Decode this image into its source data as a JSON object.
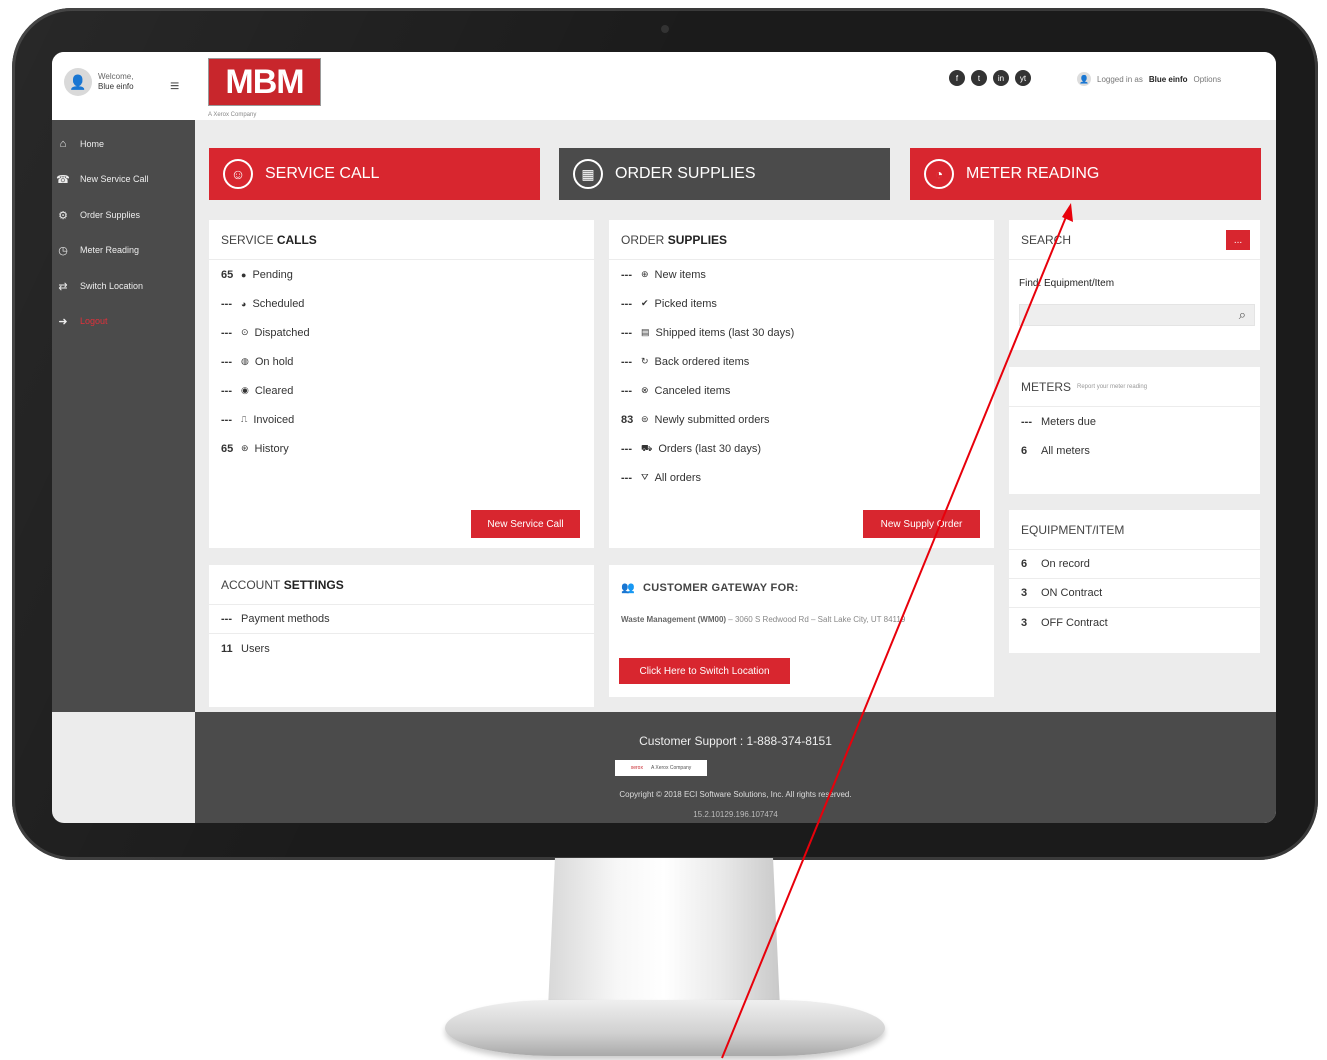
{
  "header": {
    "welcome": "Welcome,",
    "user": "Blue einfo",
    "logo": "MBM",
    "logo_tag": "A Xerox Company",
    "logged_in_label": "Logged in as",
    "logged_in_user": "Blue einfo",
    "options": "Options",
    "socials": [
      "f",
      "t",
      "in",
      "yt"
    ]
  },
  "sidebar": {
    "items": [
      {
        "icon": "⌂",
        "label": "Home"
      },
      {
        "icon": "☎",
        "label": "New Service Call"
      },
      {
        "icon": "⚙",
        "label": "Order Supplies"
      },
      {
        "icon": "◷",
        "label": "Meter Reading"
      },
      {
        "icon": "⇄",
        "label": "Switch Location"
      },
      {
        "icon": "➜",
        "label": "Logout"
      }
    ]
  },
  "tiles": {
    "service_call": "SERVICE CALL",
    "order_supplies": "ORDER SUPPLIES",
    "meter_reading": "METER READING"
  },
  "service_calls": {
    "title_light": "SERVICE",
    "title_bold": "CALLS",
    "rows": [
      {
        "count": "65",
        "label": "Pending"
      },
      {
        "count": "---",
        "label": "Scheduled"
      },
      {
        "count": "---",
        "label": "Dispatched"
      },
      {
        "count": "---",
        "label": "On hold"
      },
      {
        "count": "---",
        "label": "Cleared"
      },
      {
        "count": "---",
        "label": "Invoiced"
      },
      {
        "count": "65",
        "label": "History"
      }
    ],
    "button": "New Service Call"
  },
  "order_supplies": {
    "title_light": "ORDER",
    "title_bold": "SUPPLIES",
    "rows": [
      {
        "count": "---",
        "label": "New items"
      },
      {
        "count": "---",
        "label": "Picked items"
      },
      {
        "count": "---",
        "label": "Shipped items (last 30 days)"
      },
      {
        "count": "---",
        "label": "Back ordered items"
      },
      {
        "count": "---",
        "label": "Canceled items"
      },
      {
        "count": "83",
        "label": "Newly submitted orders"
      },
      {
        "count": "---",
        "label": "Orders (last 30 days)"
      },
      {
        "count": "---",
        "label": "All orders"
      }
    ],
    "button": "New Supply Order"
  },
  "search": {
    "title": "SEARCH",
    "more": "...",
    "find_label": "Find: Equipment/Item",
    "placeholder": ""
  },
  "meters": {
    "title": "METERS",
    "subtitle": "Report your meter reading",
    "rows": [
      {
        "count": "---",
        "label": "Meters due"
      },
      {
        "count": "6",
        "label": "All meters"
      }
    ]
  },
  "equipment": {
    "title": "EQUIPMENT/ITEM",
    "rows": [
      {
        "count": "6",
        "label": "On record"
      },
      {
        "count": "3",
        "label": "ON Contract"
      },
      {
        "count": "3",
        "label": "OFF Contract"
      }
    ]
  },
  "account": {
    "title_light": "ACCOUNT",
    "title_bold": "SETTINGS",
    "rows": [
      {
        "count": "---",
        "label": "Payment methods"
      },
      {
        "count": "11",
        "label": "Users"
      }
    ]
  },
  "gateway": {
    "title": "CUSTOMER GATEWAY FOR:",
    "company": "Waste Management (WM00)",
    "address": " – 3060 S Redwood Rd – Salt Lake City, UT 84119",
    "button": "Click Here to Switch Location"
  },
  "footer": {
    "support": "Customer Support : 1-888-374-8151",
    "logo_left": "xerox",
    "logo_right": "A Xerox Company",
    "copyright": "Copyright © 2018 ECI Software Solutions, Inc. All rights reserved.",
    "version": "15.2.10129.196.107474"
  },
  "colors": {
    "accent": "#d8262f",
    "dark": "#4b4b4b",
    "annotation": "#e8000b"
  }
}
